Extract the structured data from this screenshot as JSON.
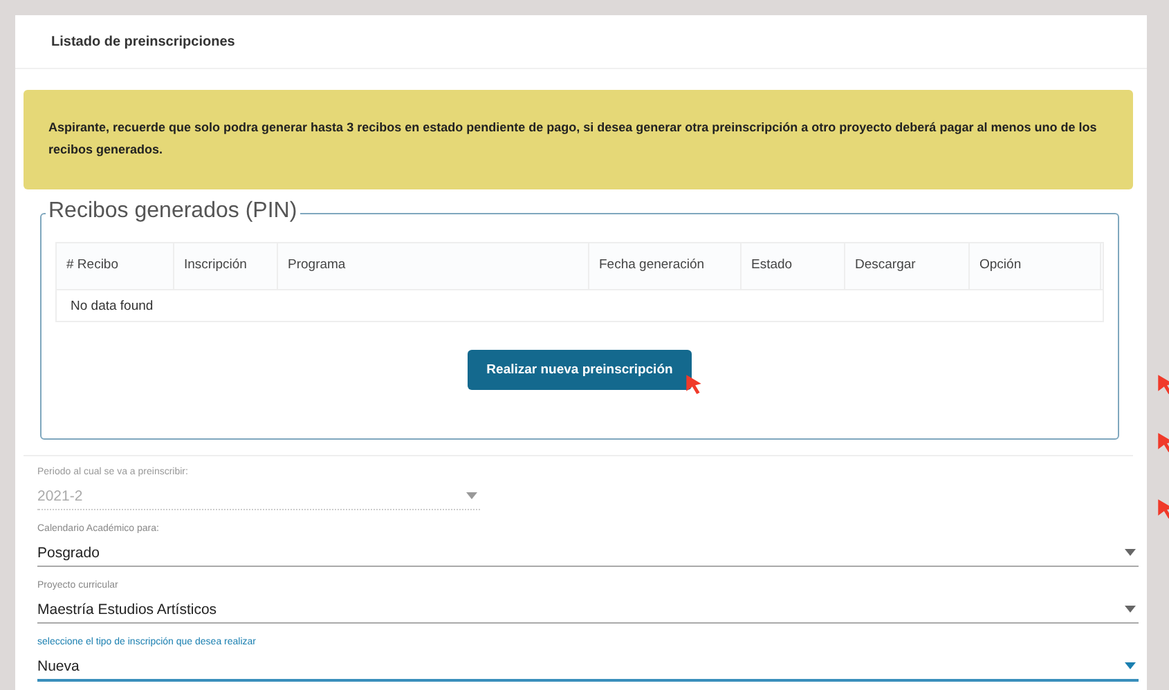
{
  "panel": {
    "title": "Listado de preinscripciones"
  },
  "alert": {
    "text": "Aspirante, recuerde que solo podra generar hasta 3 recibos en estado pendiente de pago, si desea generar otra preinscripción a otro proyecto deberá pagar al menos uno de los recibos generados."
  },
  "receipts": {
    "legend": "Recibos generados (PIN)",
    "columns": [
      "# Recibo",
      "Inscripción",
      "Programa",
      "Fecha generación",
      "Estado",
      "Descargar",
      "Opción"
    ],
    "empty_message": "No data found",
    "button": "Realizar nueva preinscripción"
  },
  "fields": [
    {
      "kind": "short",
      "label": "Periodo al cual se va a preinscribir:",
      "value": "2021-2",
      "disabled": true,
      "focused": false
    },
    {
      "kind": "full",
      "label": "Calendario Académico para:",
      "value": "Posgrado",
      "disabled": false,
      "focused": false
    },
    {
      "kind": "full",
      "label": "Proyecto curricular",
      "value": "Maestría Estudios Artísticos",
      "disabled": false,
      "focused": false
    },
    {
      "kind": "full",
      "label": "seleccione el tipo de inscripción que desea realizar",
      "value": "Nueva",
      "disabled": false,
      "focused": true
    }
  ]
}
